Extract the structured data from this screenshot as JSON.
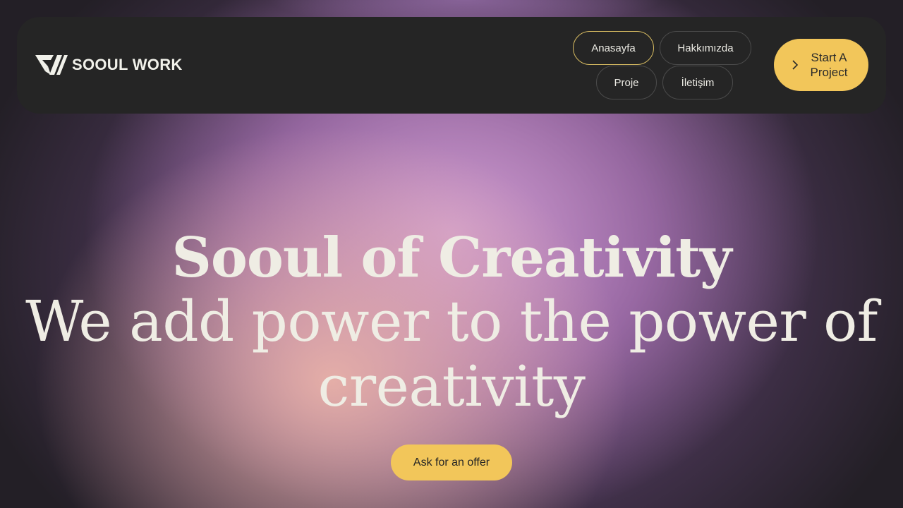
{
  "brand": {
    "name": "SOOUL WORK",
    "logo_icon": "sw-monogram-icon"
  },
  "nav": {
    "items": [
      {
        "label": "Anasayfa",
        "active": true
      },
      {
        "label": "Hakkımızda",
        "active": false
      },
      {
        "label": "Proje",
        "active": false
      },
      {
        "label": "İletişim",
        "active": false
      }
    ],
    "cta_label": "Start A Project",
    "cta_icon": "chevron-right-icon"
  },
  "hero": {
    "title": "Sooul of Creativity",
    "subtitle": "We add power to the power of creativity",
    "offer_button": "Ask for an offer"
  },
  "colors": {
    "accent": "#f2c65a",
    "navbar_bg": "#252525",
    "text_light": "#efede4",
    "active_border": "#d9bd62"
  }
}
